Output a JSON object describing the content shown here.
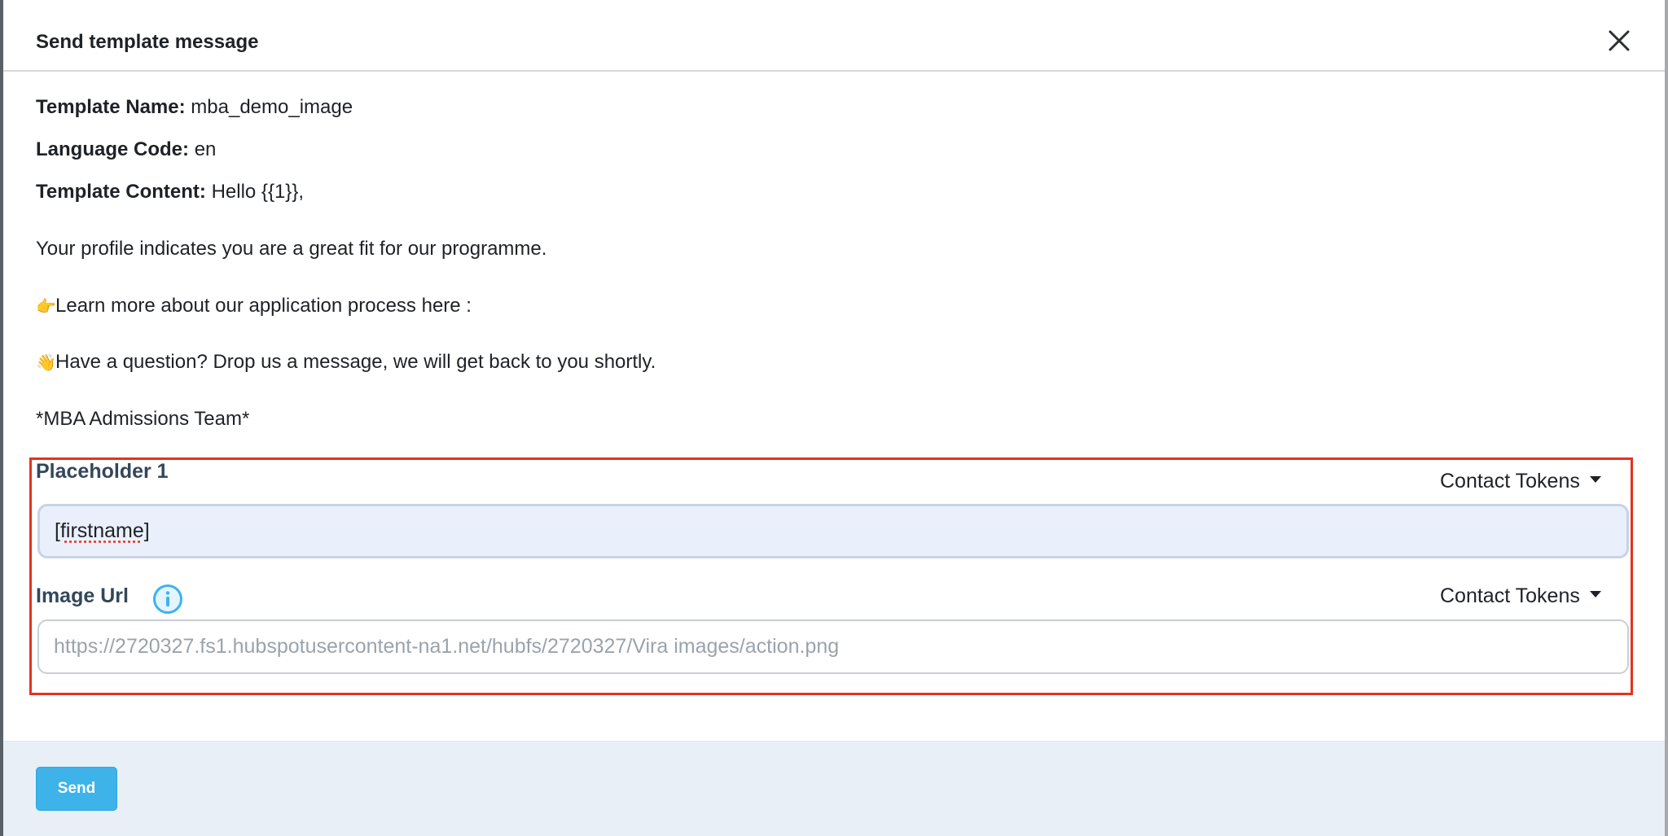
{
  "modal": {
    "title": "Send template message"
  },
  "template": {
    "name_label": "Template Name:",
    "name_value": "mba_demo_image",
    "language_label": "Language Code:",
    "language_value": "en",
    "content_label": "Template Content:",
    "content_first_line": "Hello {{1}},",
    "content_lines": [
      {
        "emoji": "",
        "text": "Your profile indicates you are a great fit for our programme."
      },
      {
        "emoji": "👉",
        "emoji_name": "pointing-hand-icon",
        "text": "Learn more about our application process here :"
      },
      {
        "emoji": "👋",
        "emoji_name": "waving-hand-icon",
        "text": "Have a question? Drop us a message, we will get back to you shortly."
      },
      {
        "emoji": "",
        "text": "*MBA Admissions Team*"
      }
    ]
  },
  "fields": {
    "placeholder1": {
      "label": "Placeholder 1",
      "tokens_label": "Contact Tokens",
      "value": "[firstname]"
    },
    "image_url": {
      "label": "Image Url",
      "tokens_label": "Contact Tokens",
      "placeholder": "https://2720327.fs1.hubspotusercontent-na1.net/hubfs/2720327/Vira images/action.png"
    }
  },
  "footer": {
    "send_label": "Send"
  },
  "colors": {
    "accent": "#3db3ea",
    "highlight_border": "#e5321e",
    "label_text": "#33475b",
    "footer_bg": "#e9eff7",
    "filled_input_bg": "#eaf0fb"
  }
}
